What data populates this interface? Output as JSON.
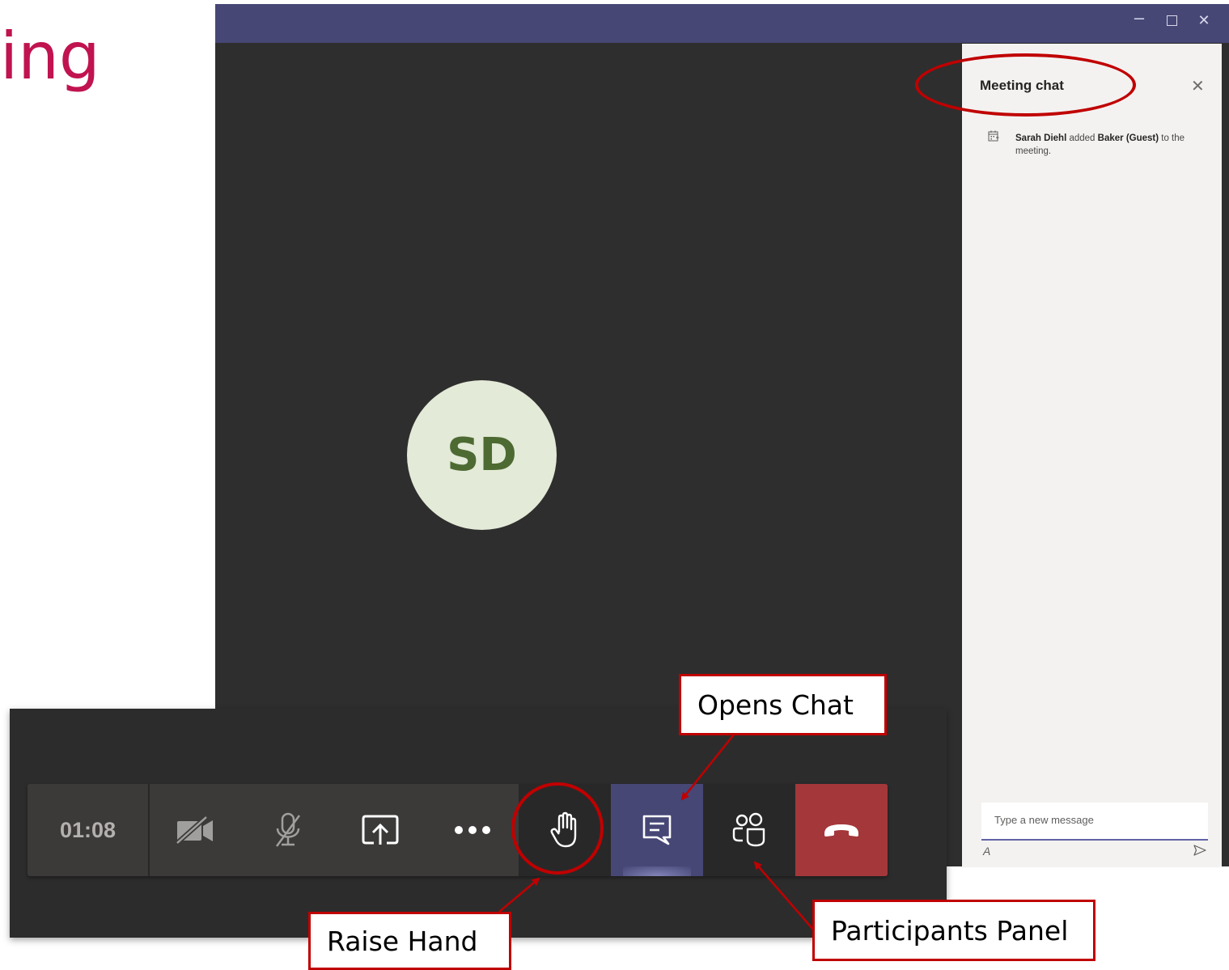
{
  "slide": {
    "title": "ing"
  },
  "window": {
    "controls": {
      "minimize": "–",
      "close": "✕"
    }
  },
  "avatar": {
    "initials": "SD"
  },
  "chat": {
    "title": "Meeting chat",
    "close_glyph": "✕",
    "event": {
      "actor": "Sarah Diehl",
      "verb": " added ",
      "guest": "Baker (Guest)",
      "rest": " to the meeting."
    },
    "compose": {
      "placeholder": "Type a new message"
    },
    "format_glyph": "A"
  },
  "toolbar": {
    "timer": "01:08",
    "buttons": [
      "camera-off-icon",
      "mic-off-icon",
      "share-screen-icon",
      "more-options-icon",
      "raise-hand-icon",
      "chat-icon",
      "participants-icon",
      "hang-up-icon"
    ]
  },
  "callouts": {
    "opens_chat": "Opens Chat",
    "raise_hand": "Raise Hand",
    "participants": "Participants Panel"
  },
  "colors": {
    "accent": "#464775",
    "brand_title": "#c0134f",
    "highlight": "#c00000",
    "hangup": "#a4373a"
  }
}
